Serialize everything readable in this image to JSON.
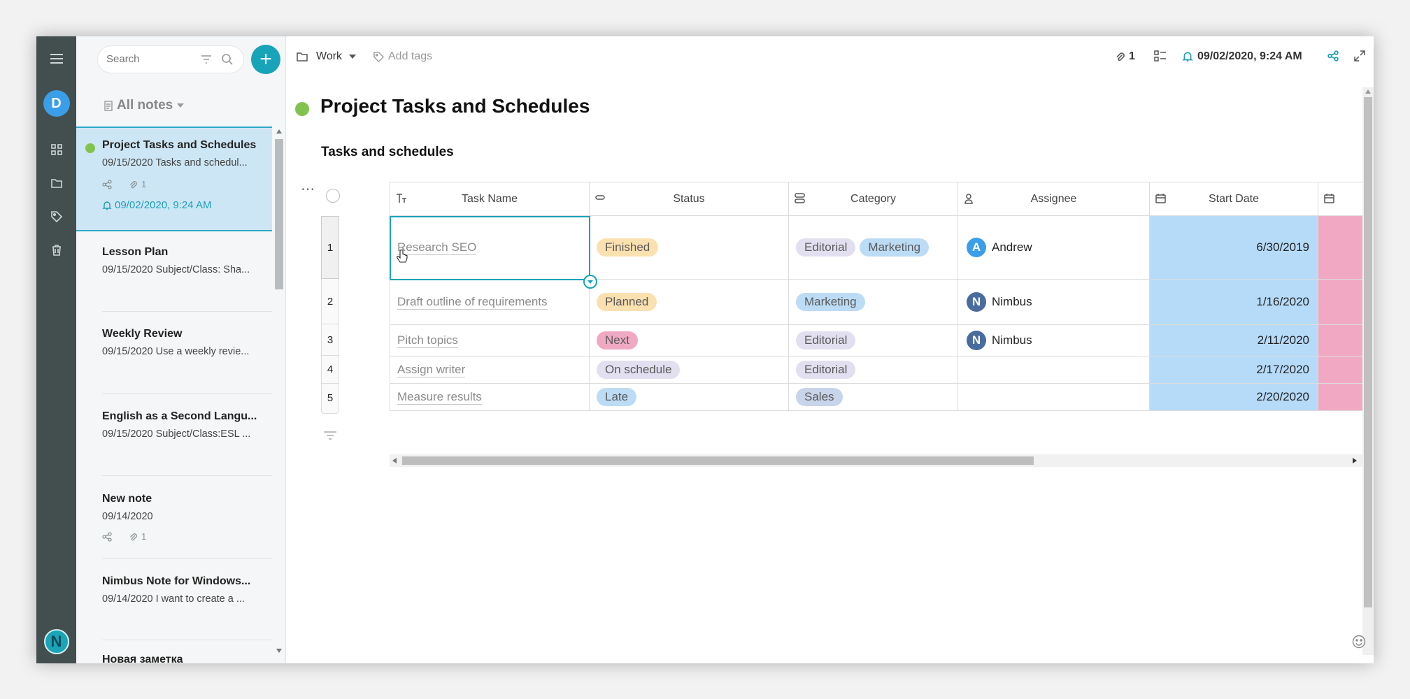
{
  "sidebar": {
    "user_initial": "D",
    "brand_initial": "N"
  },
  "notelist": {
    "search_placeholder": "Search",
    "filter_label": "All notes",
    "notes": [
      {
        "title": "Project Tasks and Schedules",
        "snippet": "09/15/2020 Tasks and schedul...",
        "attachments": "1",
        "reminder": "09/02/2020, 9:24 AM"
      },
      {
        "title": "Lesson Plan",
        "snippet": "09/15/2020 Subject/Class: Sha..."
      },
      {
        "title": "Weekly Review",
        "snippet": "09/15/2020 Use a weekly revie..."
      },
      {
        "title": "English as a Second Langu...",
        "snippet": "09/15/2020 Subject/Class:ESL ..."
      },
      {
        "title": "New note",
        "snippet": "09/14/2020",
        "attachments": "1"
      },
      {
        "title": "Nimbus Note for Windows...",
        "snippet": "09/14/2020 I want to create a ..."
      },
      {
        "title": "Новая заметка"
      }
    ]
  },
  "toolbar": {
    "folder": "Work",
    "add_tags": "Add tags",
    "attachment_count": "1",
    "reminder": "09/02/2020, 9:24 AM"
  },
  "note": {
    "title": "Project Tasks and Schedules",
    "subheading": "Tasks and schedules"
  },
  "colors": {
    "accent": "#17a3b8",
    "status_green": "#82c34f",
    "date_column": "#b6dbf9",
    "pink_column": "#f1a9c3"
  },
  "table": {
    "columns": [
      "Task Name",
      "Status",
      "Category",
      "Assignee",
      "Start Date"
    ],
    "rows": [
      {
        "num": "1",
        "task": "Research SEO",
        "status": "Finished",
        "categories": [
          "Editorial",
          "Marketing"
        ],
        "assignee": "Andrew",
        "assignee_initial": "A",
        "start": "6/30/2019"
      },
      {
        "num": "2",
        "task": "Draft outline of requirements",
        "status": "Planned",
        "categories": [
          "Marketing"
        ],
        "assignee": "Nimbus",
        "assignee_initial": "N",
        "start": "1/16/2020"
      },
      {
        "num": "3",
        "task": "Pitch topics",
        "status": "Next",
        "categories": [
          "Editorial"
        ],
        "assignee": "Nimbus",
        "assignee_initial": "N",
        "start": "2/11/2020"
      },
      {
        "num": "4",
        "task": "Assign writer",
        "status": "On schedule",
        "categories": [
          "Editorial"
        ],
        "assignee": "",
        "assignee_initial": "",
        "start": "2/17/2020"
      },
      {
        "num": "5",
        "task": "Measure results",
        "status": "Late",
        "categories": [
          "Sales"
        ],
        "assignee": "",
        "assignee_initial": "",
        "start": "2/20/2020"
      }
    ]
  }
}
